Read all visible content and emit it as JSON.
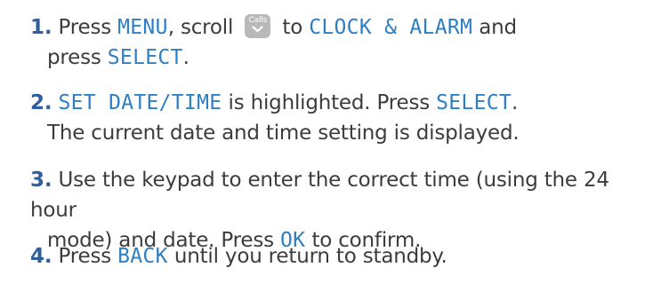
{
  "steps": [
    {
      "number": "1",
      "dot": ".",
      "parts": {
        "a": "Press ",
        "menu": "MENU",
        "b": ", scroll ",
        "key_label": "Calls",
        "key_icon": "chevron-down-icon",
        "c": " to ",
        "clock": "CLOCK & ALARM",
        "d": " and",
        "e": "press ",
        "select": "SELECT",
        "f": "."
      }
    },
    {
      "number": "2",
      "dot": ".",
      "parts": {
        "set": "SET DATE/TIME",
        "a": " is highlighted. Press ",
        "select": "SELECT",
        "b": ".",
        "line2": "The current date and time setting is displayed."
      }
    },
    {
      "number": "3",
      "dot": ".",
      "parts": {
        "a": "Use the keypad to enter the correct time (using the 24 hour",
        "b": "mode) and date. Press ",
        "ok": "OK",
        "c": " to confirm."
      }
    },
    {
      "number": "4",
      "dot": ".",
      "parts": {
        "a": "Press ",
        "back": "BACK",
        "b": " until you return to standby."
      }
    }
  ],
  "colors": {
    "step_number": "#2f5f9e",
    "lcd_text": "#2f7fc4",
    "body_text": "#3c3c3c",
    "key_background": "#b9b9b9"
  }
}
